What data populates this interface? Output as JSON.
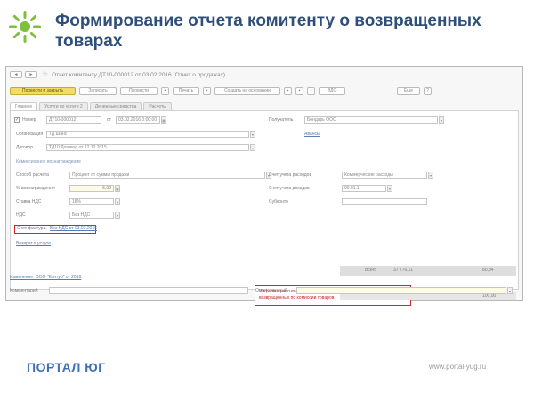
{
  "slide": {
    "title": "Формирование отчета комитенту о возвращенных товарах"
  },
  "window": {
    "doc_title": "Отчет комитенту ДТ10-000012 от 03.02.2016 (Отчет о продажах)",
    "nav_back": "◄",
    "nav_forward": "►",
    "star": "☆"
  },
  "toolbar": {
    "post_close": "Провести и закрыть",
    "write": "Записать",
    "post": "Провести",
    "print": "Печать",
    "create_based": "Создать на основании",
    "edo": "ЭДО",
    "more": "Еще"
  },
  "tabs": [
    "Главное",
    "Услуги по услуге 2",
    "Денежные средства",
    "Расчеты"
  ],
  "form": {
    "number_label": "Номер",
    "number_value": "ДТ10-000012",
    "date_label": "от",
    "date_value": "03.02.2016 0:00:00",
    "org_label": "Организация",
    "org_value": "ТД Шанс",
    "contract_label": "Договор",
    "contract_value": "ТД10 Договор от 12.12.2015",
    "recipient_label": "Получатель",
    "recipient_value": "Бондарь ООО",
    "advance_link": "Авансы",
    "commission_section": "Комиссионное вознаграждение",
    "calc_method_label": "Способ расчета",
    "calc_method_value": "Процент от суммы продажи",
    "fee_percent_label": "% вознаграждения",
    "fee_percent_value": "5,00",
    "vat_rate_label": "Ставка НДС",
    "vat_rate_value": "18%",
    "vat_label": "НДС",
    "vat_value": "Без НДС",
    "invoice_label": "Счет-фактура:",
    "invoice_value": "Без НДС от 03.02.2016",
    "expense_acc_label": "Счет учета расходов",
    "expense_acc_value": "Коммерческие расходы",
    "inventory_acc_label": "Счет учета доходов",
    "inventory_acc_value": "90.01.1",
    "subconto_label": "Субконто",
    "total_label": "Всего",
    "total_value": "37 776,11",
    "vat_total_value": "80,34",
    "return_link": "Возврат в услуге",
    "payment_value": "100,00",
    "author_link": "Изменение: ООО \"Контур\" от 2016",
    "comment_label": "Комментарий",
    "responsible_label": "Ответственный"
  },
  "callout": {
    "text": "Информация о возвращенном по фактуре - регистрация возвращенных по комиссии товаров"
  },
  "footer": {
    "brand": "ПОРТАЛ ЮГ",
    "site": "www.portal-yug.ru"
  },
  "colors": {
    "title": "#2f4f7a",
    "brand": "#3e6fb5",
    "accent_button": "#f3dc66",
    "highlight": "#dd2222"
  }
}
